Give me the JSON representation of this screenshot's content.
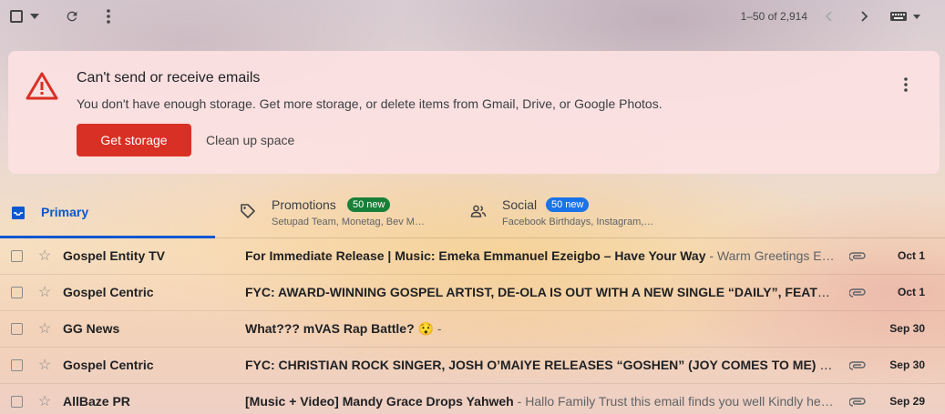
{
  "toolbar": {
    "range_text": "1–50 of 2,914"
  },
  "banner": {
    "title": "Can't send or receive emails",
    "message": "You don't have enough storage. Get more storage, or delete items from Gmail, Drive, or Google Photos.",
    "primary_button": "Get storage",
    "secondary_button": "Clean up space",
    "accent_color": "#d93025"
  },
  "tabs": [
    {
      "label": "Primary",
      "icon": "inbox-icon",
      "selected": true
    },
    {
      "label": "Promotions",
      "icon": "tag-icon",
      "badge": "50 new",
      "badge_color": "#188038",
      "subtitle": "Setupad Team, Monetag, Bev M…"
    },
    {
      "label": "Social",
      "icon": "people-icon",
      "badge": "50 new",
      "badge_color": "#1a73e8",
      "subtitle": "Facebook Birthdays, Instagram,…"
    }
  ],
  "emails": [
    {
      "sender": "Gospel Entity TV",
      "subject": "For Immediate Release | Music: Emeka Emmanuel Ezeigbo – Have Your Way",
      "snippet": "Warm Greetings E…",
      "attachment": true,
      "date": "Oct 1"
    },
    {
      "sender": "Gospel Centric",
      "subject": "FYC: AWARD-WINNING GOSPEL ARTIST, DE-OLA IS OUT WITH A NEW SINGLE “DAILY”, FEATU…",
      "snippet": "",
      "attachment": true,
      "date": "Oct 1"
    },
    {
      "sender": "GG News",
      "subject": "What??? mVAS Rap Battle? 😯",
      "snippet": "",
      "attachment": false,
      "date": "Sep 30"
    },
    {
      "sender": "Gospel Centric",
      "subject": "FYC: CHRISTIAN ROCK SINGER, JOSH O’MAIYE RELEASES “GOSHEN” (JOY COMES TO ME) FE…",
      "snippet": "",
      "attachment": true,
      "date": "Sep 30"
    },
    {
      "sender": "AllBaze PR",
      "subject": "[Music + Video] Mandy Grace Drops Yahweh",
      "snippet": "Hallo Family Trust this email finds you well Kindly he…",
      "attachment": true,
      "date": "Sep 29"
    }
  ]
}
